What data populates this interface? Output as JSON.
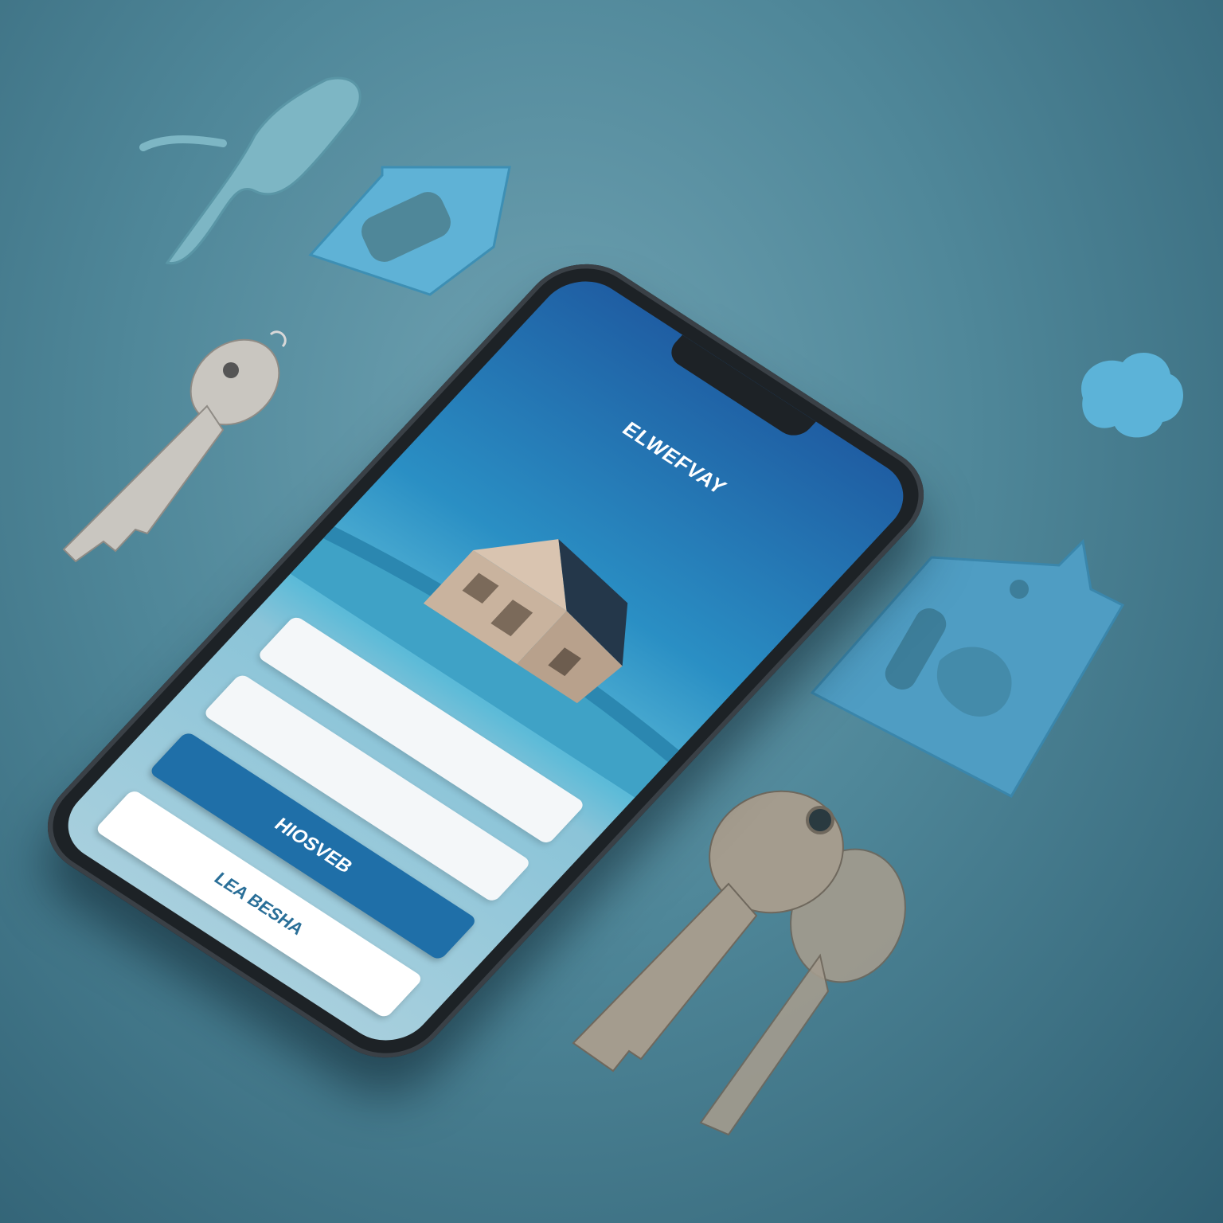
{
  "app": {
    "title": "ELWEFVAY"
  },
  "login_form": {
    "username_placeholder": "",
    "password_placeholder": "",
    "primary_button_label": "HIOSVEB",
    "secondary_button_label": "LEA BESHA"
  },
  "colors": {
    "background": "#4f8799",
    "phone_body": "#1d2226",
    "screen_top": "#1f5ea3",
    "screen_bottom": "#a7cfdd",
    "primary_button": "#1f6fa8",
    "secondary_button": "#ffffff",
    "accent_cutout": "#5fb2d6"
  },
  "icons": {
    "hero": "house-illustration",
    "props": [
      "key-icon",
      "house-cutout-icon",
      "cloud-icon",
      "figurine-icon"
    ]
  }
}
